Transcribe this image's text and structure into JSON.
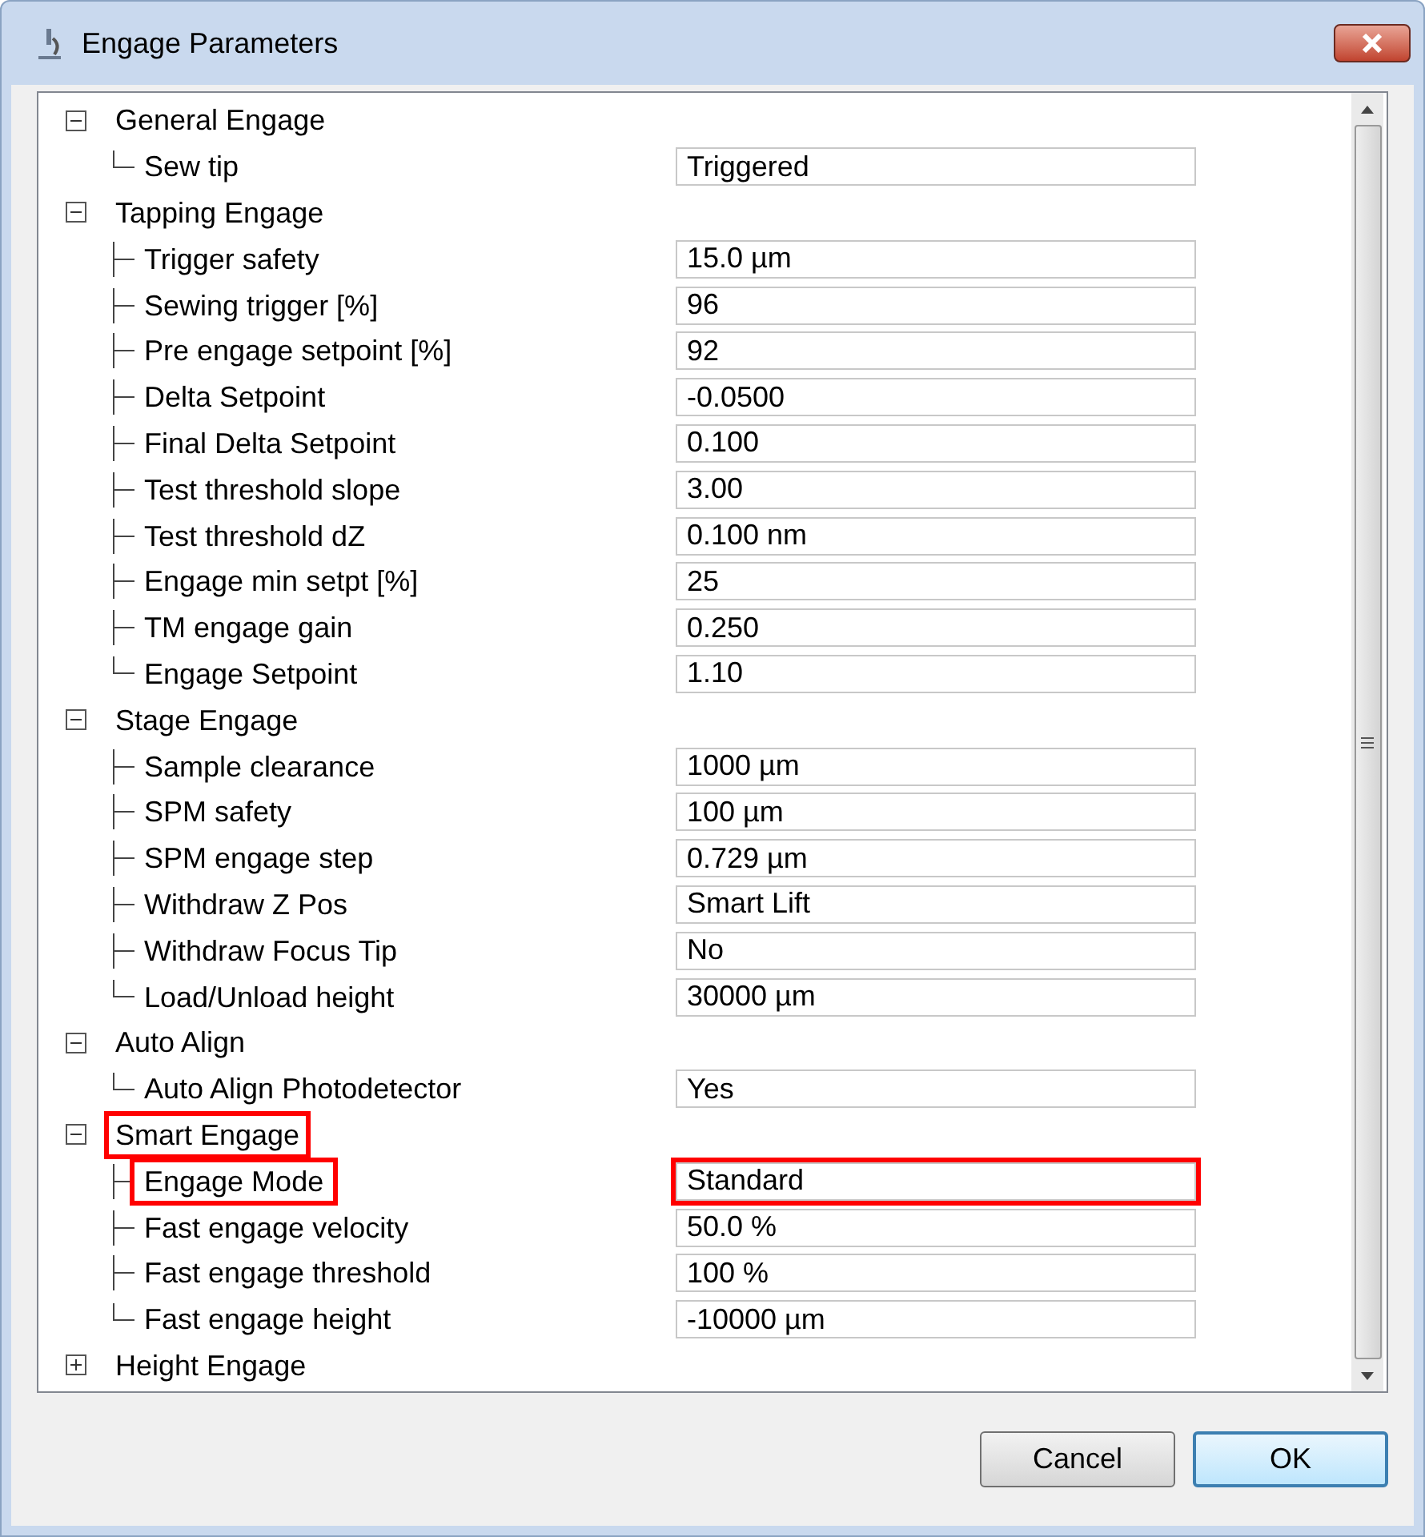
{
  "window": {
    "title": "Engage Parameters"
  },
  "groups": [
    {
      "label": "General Engage",
      "expanded": true,
      "highlighted": false,
      "children": [
        {
          "label": "Sew tip",
          "value": "Triggered",
          "label_highlighted": false,
          "value_highlighted": false
        }
      ]
    },
    {
      "label": "Tapping Engage",
      "expanded": true,
      "highlighted": false,
      "children": [
        {
          "label": "Trigger safety",
          "value": "15.0 µm",
          "label_highlighted": false,
          "value_highlighted": false
        },
        {
          "label": "Sewing trigger [%]",
          "value": "96",
          "label_highlighted": false,
          "value_highlighted": false
        },
        {
          "label": "Pre engage setpoint [%]",
          "value": "92",
          "label_highlighted": false,
          "value_highlighted": false
        },
        {
          "label": "Delta Setpoint",
          "value": "-0.0500",
          "label_highlighted": false,
          "value_highlighted": false
        },
        {
          "label": "Final Delta Setpoint",
          "value": "0.100",
          "label_highlighted": false,
          "value_highlighted": false
        },
        {
          "label": "Test threshold slope",
          "value": "3.00",
          "label_highlighted": false,
          "value_highlighted": false
        },
        {
          "label": "Test threshold dZ",
          "value": "0.100 nm",
          "label_highlighted": false,
          "value_highlighted": false
        },
        {
          "label": "Engage min setpt [%]",
          "value": "25",
          "label_highlighted": false,
          "value_highlighted": false
        },
        {
          "label": "TM engage gain",
          "value": "0.250",
          "label_highlighted": false,
          "value_highlighted": false
        },
        {
          "label": "Engage Setpoint",
          "value": "1.10",
          "label_highlighted": false,
          "value_highlighted": false
        }
      ]
    },
    {
      "label": "Stage Engage",
      "expanded": true,
      "highlighted": false,
      "children": [
        {
          "label": "Sample clearance",
          "value": "1000 µm",
          "label_highlighted": false,
          "value_highlighted": false
        },
        {
          "label": "SPM safety",
          "value": "100 µm",
          "label_highlighted": false,
          "value_highlighted": false
        },
        {
          "label": "SPM engage step",
          "value": "0.729 µm",
          "label_highlighted": false,
          "value_highlighted": false
        },
        {
          "label": "Withdraw Z Pos",
          "value": "Smart Lift",
          "label_highlighted": false,
          "value_highlighted": false
        },
        {
          "label": "Withdraw Focus Tip",
          "value": "No",
          "label_highlighted": false,
          "value_highlighted": false
        },
        {
          "label": "Load/Unload height",
          "value": "30000 µm",
          "label_highlighted": false,
          "value_highlighted": false
        }
      ]
    },
    {
      "label": "Auto Align",
      "expanded": true,
      "highlighted": false,
      "children": [
        {
          "label": "Auto Align Photodetector",
          "value": "Yes",
          "label_highlighted": false,
          "value_highlighted": false
        }
      ]
    },
    {
      "label": "Smart Engage",
      "expanded": true,
      "highlighted": true,
      "children": [
        {
          "label": "Engage Mode",
          "value": "Standard",
          "label_highlighted": true,
          "value_highlighted": true
        },
        {
          "label": "Fast engage velocity",
          "value": "50.0 %",
          "label_highlighted": false,
          "value_highlighted": false
        },
        {
          "label": "Fast engage threshold",
          "value": "100 %",
          "label_highlighted": false,
          "value_highlighted": false
        },
        {
          "label": "Fast engage height",
          "value": "-10000 µm",
          "label_highlighted": false,
          "value_highlighted": false
        }
      ]
    },
    {
      "label": "Height Engage",
      "expanded": false,
      "highlighted": false
    }
  ],
  "buttons": [
    {
      "label": "Cancel",
      "default": false
    },
    {
      "label": "OK",
      "default": true
    }
  ]
}
